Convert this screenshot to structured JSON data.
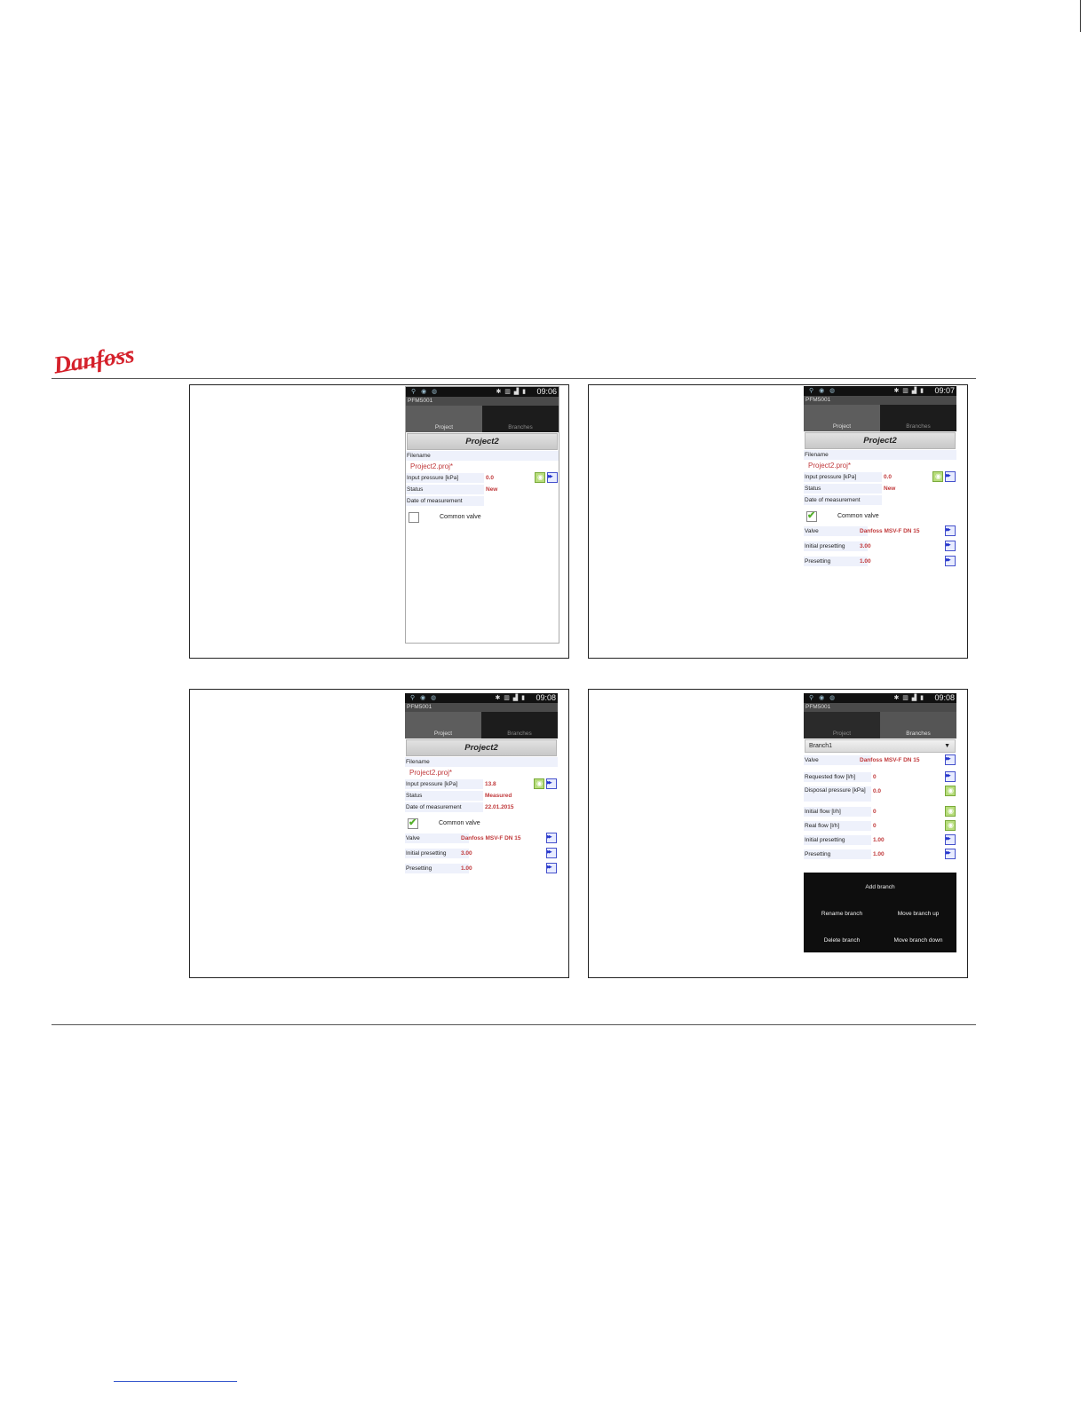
{
  "logo_text": "Danfoss",
  "brand_color": "#d5212b",
  "screen1": {
    "status_time": "09:06",
    "app_title": "PFM5001",
    "tabs": [
      "Project",
      "Branches"
    ],
    "project_title": "Project2",
    "filename_label": "Filename",
    "filename_value": "Project2.proj*",
    "rows": [
      {
        "label": "Input pressure [kPa]",
        "value": "0.0"
      },
      {
        "label": "Status",
        "value": "New"
      },
      {
        "label": "Date of measurement",
        "value": ""
      }
    ],
    "common_valve_label": "Common valve",
    "common_valve_checked": false
  },
  "screen2": {
    "status_time": "09:07",
    "app_title": "PFM5001",
    "tabs": [
      "Project",
      "Branches"
    ],
    "project_title": "Project2",
    "filename_label": "Filename",
    "filename_value": "Project2.proj*",
    "rows": [
      {
        "label": "Input pressure [kPa]",
        "value": "0.0"
      },
      {
        "label": "Status",
        "value": "New"
      },
      {
        "label": "Date of measurement",
        "value": ""
      }
    ],
    "common_valve_label": "Common valve",
    "common_valve_checked": true,
    "valve_rows": [
      {
        "label": "Valve",
        "value": "Danfoss MSV-F  DN 15"
      },
      {
        "label": "Initial presetting",
        "value": "3.00"
      },
      {
        "label": "Presetting",
        "value": "1.00"
      }
    ]
  },
  "screen3": {
    "status_time": "09:08",
    "app_title": "PFM5001",
    "tabs": [
      "Project",
      "Branches"
    ],
    "project_title": "Project2",
    "filename_label": "Filename",
    "filename_value": "Project2.proj*",
    "rows": [
      {
        "label": "Input pressure [kPa]",
        "value": "13.8"
      },
      {
        "label": "Status",
        "value": "Measured"
      },
      {
        "label": "Date of measurement",
        "value": "22.01.2015"
      }
    ],
    "common_valve_label": "Common valve",
    "common_valve_checked": true,
    "valve_rows": [
      {
        "label": "Valve",
        "value": "Danfoss MSV-F  DN 15"
      },
      {
        "label": "Initial presetting",
        "value": "3.00"
      },
      {
        "label": "Presetting",
        "value": "1.00"
      }
    ]
  },
  "screen4": {
    "status_time": "09:08",
    "app_title": "PFM5001",
    "tabs": [
      "Project",
      "Branches"
    ],
    "branch_select": "Branch1",
    "rows": [
      {
        "label": "Valve",
        "value": "Danfoss MSV-F  DN 15"
      },
      {
        "label": "Requested flow [l/h]",
        "value": "0"
      },
      {
        "label": "Disposal pressure [kPa]",
        "value": "0.0"
      },
      {
        "label": "Initial flow [l/h]",
        "value": "0"
      },
      {
        "label": "Real flow [l/h]",
        "value": "0"
      },
      {
        "label": "Initial presetting",
        "value": "1.00"
      },
      {
        "label": "Presetting",
        "value": "1.00"
      }
    ],
    "menu": {
      "add": "Add branch",
      "rename": "Rename branch",
      "move_up": "Move branch up",
      "delete": "Delete branch",
      "move_down": "Move branch down"
    }
  }
}
